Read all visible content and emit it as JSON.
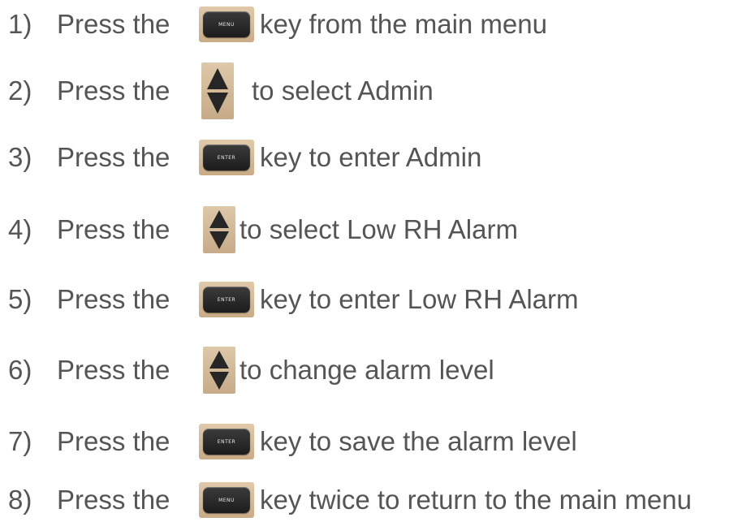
{
  "steps": [
    {
      "number": "1)",
      "prefix": "Press the",
      "icon": "menu-key",
      "key_label": "MENU",
      "text": "key from the main menu"
    },
    {
      "number": "2)",
      "prefix": "Press the",
      "icon": "up-down-arrow-key",
      "text": "to select Admin"
    },
    {
      "number": "3)",
      "prefix": "Press the",
      "icon": "enter-key",
      "key_label": "ENTER",
      "text": "key to enter Admin"
    },
    {
      "number": "4)",
      "prefix": "Press the",
      "icon": "up-down-arrow-key",
      "text": "to select Low RH Alarm"
    },
    {
      "number": "5)",
      "prefix": "Press the",
      "icon": "enter-key",
      "key_label": "ENTER",
      "text": "key to enter Low RH Alarm"
    },
    {
      "number": "6)",
      "prefix": "Press the",
      "icon": "up-down-arrow-key",
      "text": "to change alarm level"
    },
    {
      "number": "7)",
      "prefix": "Press the",
      "icon": "enter-key",
      "key_label": "ENTER",
      "text": "key to save the alarm level"
    },
    {
      "number": "8)",
      "prefix": "Press the",
      "icon": "menu-key",
      "key_label": "MENU",
      "text": "key twice to return to the main menu"
    }
  ],
  "colors": {
    "text": "#555555",
    "key_body": "#2a2a2a",
    "key_surround": "#d6bd9a"
  }
}
